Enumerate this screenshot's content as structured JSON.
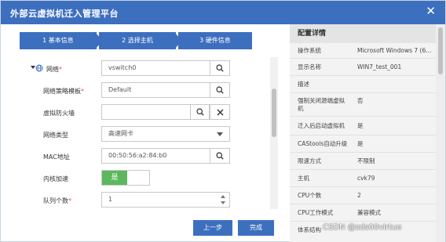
{
  "window": {
    "title": "外部云虚拟机迁入管理平台"
  },
  "steps": [
    "1 基本信息",
    "2 选择主机",
    "3 硬件信息"
  ],
  "form": {
    "network_label": "网络",
    "network_value": "vswitch0",
    "policy_label": "网络策略模板",
    "policy_value": "Default",
    "firewall_label": "虚拟防火墙",
    "firewall_value": "",
    "nettype_label": "网络类型",
    "nettype_value": "高速网卡",
    "mac_label": "MAC地址",
    "mac_value": "00:50:56:a2:84:b0",
    "accel_label": "内核加速",
    "accel_value": "是",
    "queue_label": "队列个数",
    "queue_value": "1"
  },
  "buttons": {
    "prev": "上一步",
    "finish": "完成"
  },
  "panel": {
    "header": "配置详情",
    "rows": [
      {
        "k": "操作系统",
        "v": "Microsoft Windows 7 (6..."
      },
      {
        "k": "显示名称",
        "v": "WIN7_test_001"
      },
      {
        "k": "描述",
        "v": ""
      },
      {
        "k": "强制关闭源端虚拟机",
        "v": "否"
      },
      {
        "k": "迁入后启动虚拟机",
        "v": "是"
      },
      {
        "k": "CAStools自动升级",
        "v": "是"
      },
      {
        "k": "限速方式",
        "v": "不限制"
      },
      {
        "k": "主机",
        "v": "cvk79"
      },
      {
        "k": "CPU个数",
        "v": "2"
      },
      {
        "k": "CPU工作模式",
        "v": "兼容模式"
      },
      {
        "k": "体系结构",
        "v": ""
      }
    ]
  },
  "watermark": "CSDN @zds00virtue",
  "colors": {
    "primary": "#3d6fbf",
    "toggle_on": "#5cb85c"
  },
  "icons": [
    "close-icon",
    "search-icon",
    "x-icon",
    "caret-down-icon",
    "globe-icon",
    "spinner-up-icon",
    "spinner-down-icon"
  ]
}
